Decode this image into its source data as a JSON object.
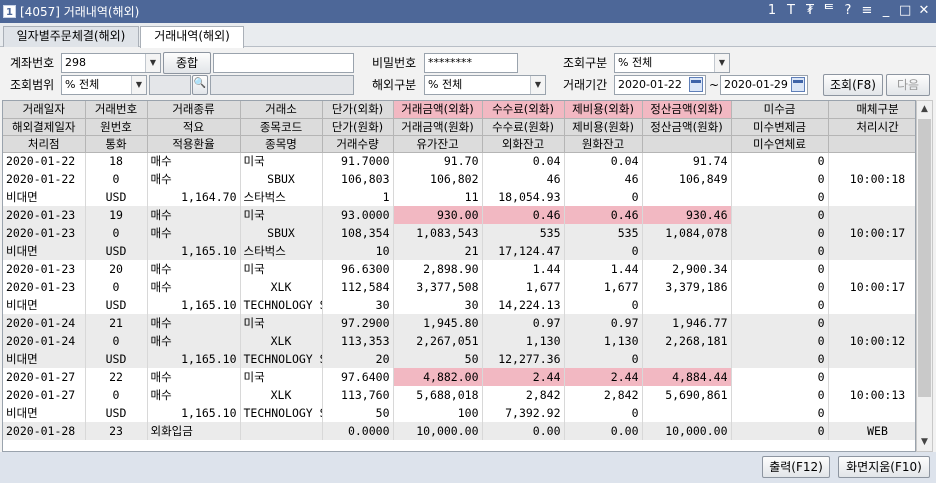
{
  "window": {
    "title": "[4057] 거래내역(해외)",
    "icon_label": "1",
    "controls": [
      "1",
      "T",
      "₮",
      "ᄐ",
      "?",
      "≡",
      "_",
      "□",
      "✕"
    ]
  },
  "tabs": [
    {
      "label": "일자별주문체결(해외)"
    },
    {
      "label": "거래내역(해외)"
    }
  ],
  "form": {
    "account_label": "계좌번호",
    "account_value": "298",
    "account_type_button": "종합",
    "account_name_value": "",
    "password_label": "비밀번호",
    "password_value": "********",
    "query_type_label": "조회구분",
    "query_type_value": "% 전체",
    "query_range_label": "조회범위",
    "query_range_value": "% 전체",
    "search_icon": "search-icon",
    "overseas_type_label": "해외구분",
    "overseas_type_value": "% 전체",
    "period_label": "거래기간",
    "date_from": "2020-01-22",
    "tilde": "~",
    "date_to": "2020-01-29",
    "query_button": "조회(F8)",
    "next_button": "다음"
  },
  "table": {
    "header_rows": [
      [
        "거래일자",
        "거래번호",
        "거래종류",
        "거래소",
        "단가(외화)",
        "거래금액(외화)",
        "수수료(외화)",
        "제비용(외화)",
        "정산금액(외화)",
        "미수금",
        "매체구분"
      ],
      [
        "해외결제일자",
        "원번호",
        "적요",
        "종목코드",
        "단가(원화)",
        "거래금액(원화)",
        "수수료(원화)",
        "제비용(원화)",
        "정산금액(원화)",
        "미수변제금",
        "처리시간"
      ],
      [
        "처리점",
        "통화",
        "적용환율",
        "종목명",
        "거래수량",
        "유가잔고",
        "외화잔고",
        "원화잔고",
        "",
        "미수연체료",
        ""
      ]
    ],
    "pink_header_columns": [
      5,
      6,
      7,
      8
    ],
    "groups": [
      {
        "shaded": false,
        "highlight": false,
        "rows": [
          [
            "2020-01-22",
            "18",
            "매수",
            "미국",
            "91.7000",
            "91.70",
            "0.04",
            "0.04",
            "91.74",
            "0",
            ""
          ],
          [
            "2020-01-22",
            "0",
            "매수",
            "SBUX",
            "106,803",
            "106,802",
            "46",
            "46",
            "106,849",
            "0",
            "10:00:18"
          ],
          [
            "비대면",
            "USD",
            "1,164.70",
            "스타벅스",
            "1",
            "11",
            "18,054.93",
            "0",
            "",
            "0",
            ""
          ]
        ]
      },
      {
        "shaded": true,
        "highlight": true,
        "rows": [
          [
            "2020-01-23",
            "19",
            "매수",
            "미국",
            "93.0000",
            "930.00",
            "0.46",
            "0.46",
            "930.46",
            "0",
            ""
          ],
          [
            "2020-01-23",
            "0",
            "매수",
            "SBUX",
            "108,354",
            "1,083,543",
            "535",
            "535",
            "1,084,078",
            "0",
            "10:00:17"
          ],
          [
            "비대면",
            "USD",
            "1,165.10",
            "스타벅스",
            "10",
            "21",
            "17,124.47",
            "0",
            "",
            "0",
            ""
          ]
        ]
      },
      {
        "shaded": false,
        "highlight": false,
        "rows": [
          [
            "2020-01-23",
            "20",
            "매수",
            "미국",
            "96.6300",
            "2,898.90",
            "1.44",
            "1.44",
            "2,900.34",
            "0",
            ""
          ],
          [
            "2020-01-23",
            "0",
            "매수",
            "XLK",
            "112,584",
            "3,377,508",
            "1,677",
            "1,677",
            "3,379,186",
            "0",
            "10:00:17"
          ],
          [
            "비대면",
            "USD",
            "1,165.10",
            "TECHNOLOGY S",
            "30",
            "30",
            "14,224.13",
            "0",
            "",
            "0",
            ""
          ]
        ]
      },
      {
        "shaded": true,
        "highlight": false,
        "rows": [
          [
            "2020-01-24",
            "21",
            "매수",
            "미국",
            "97.2900",
            "1,945.80",
            "0.97",
            "0.97",
            "1,946.77",
            "0",
            ""
          ],
          [
            "2020-01-24",
            "0",
            "매수",
            "XLK",
            "113,353",
            "2,267,051",
            "1,130",
            "1,130",
            "2,268,181",
            "0",
            "10:00:12"
          ],
          [
            "비대면",
            "USD",
            "1,165.10",
            "TECHNOLOGY S",
            "20",
            "50",
            "12,277.36",
            "0",
            "",
            "0",
            ""
          ]
        ]
      },
      {
        "shaded": false,
        "highlight": true,
        "rows": [
          [
            "2020-01-27",
            "22",
            "매수",
            "미국",
            "97.6400",
            "4,882.00",
            "2.44",
            "2.44",
            "4,884.44",
            "0",
            ""
          ],
          [
            "2020-01-27",
            "0",
            "매수",
            "XLK",
            "113,760",
            "5,688,018",
            "2,842",
            "2,842",
            "5,690,861",
            "0",
            "10:00:13"
          ],
          [
            "비대면",
            "USD",
            "1,165.10",
            "TECHNOLOGY S",
            "50",
            "100",
            "7,392.92",
            "0",
            "",
            "0",
            ""
          ]
        ]
      },
      {
        "shaded": true,
        "highlight": false,
        "rows": [
          [
            "2020-01-28",
            "23",
            "외화입금",
            "",
            "0.0000",
            "10,000.00",
            "0.00",
            "0.00",
            "10,000.00",
            "0",
            "WEB"
          ]
        ]
      }
    ]
  },
  "buttons": {
    "print": "출력(F12)",
    "clear": "화면지움(F10)"
  },
  "colors": {
    "titlebar": "#4d6798",
    "pink": "#f2b8c2",
    "bottombar": "#dde3ec"
  }
}
